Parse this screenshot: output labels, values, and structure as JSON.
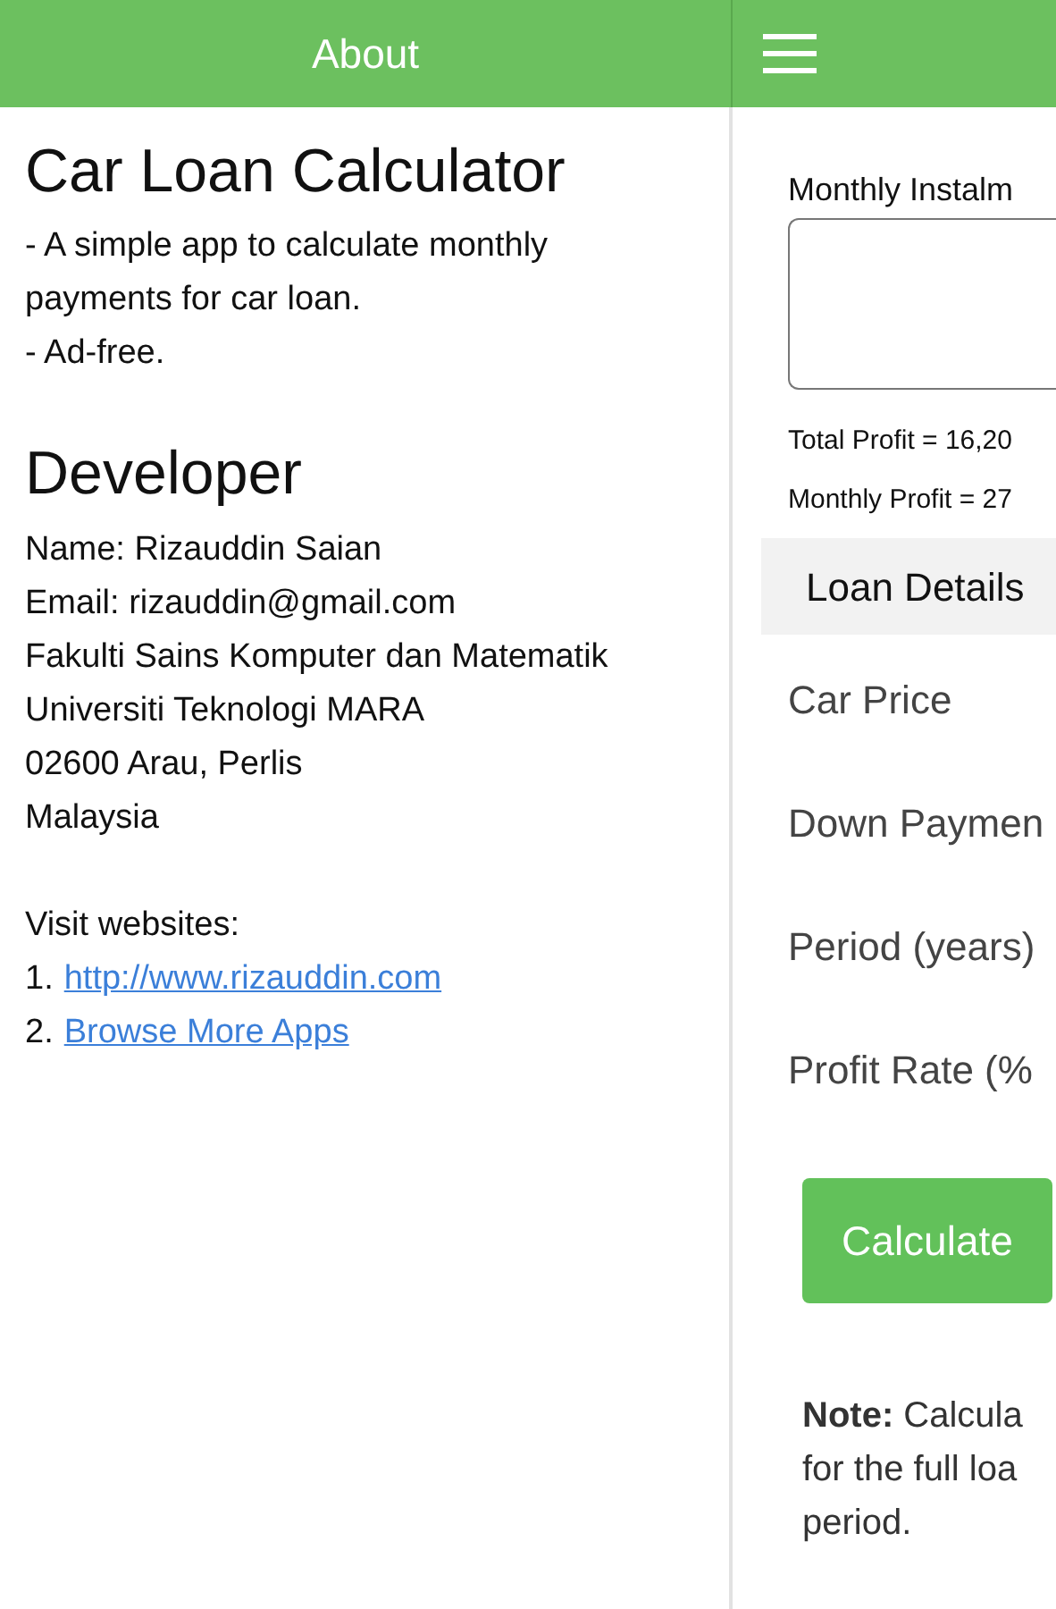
{
  "header": {
    "title": "About"
  },
  "about": {
    "title": "Car Loan Calculator",
    "description": [
      "- A simple app to calculate monthly payments for car loan.",
      "- Ad-free."
    ],
    "developer_title": "Developer",
    "developer_lines": [
      "Name: Rizauddin Saian",
      "Email: rizauddin@gmail.com",
      "Fakulti Sains Komputer dan Matematik",
      "Universiti Teknologi MARA",
      "02600 Arau, Perlis",
      "Malaysia"
    ],
    "visit_label": "Visit websites:",
    "links": [
      {
        "number": "1.",
        "text": "http://www.rizauddin.com"
      },
      {
        "number": "2.",
        "text": "Browse More Apps"
      }
    ]
  },
  "calculator": {
    "instalment_label": "Monthly Instalm",
    "total_profit": "Total Profit = 16,20",
    "monthly_profit": "Monthly Profit = 27",
    "section_title": "Loan Details",
    "fields": [
      "Car Price",
      "Down Paymen",
      "Period (years)",
      "Profit Rate (%"
    ],
    "button": "Calculate",
    "note_lines": [
      "**Note:** Calcula",
      "for the full loa",
      "period."
    ]
  }
}
